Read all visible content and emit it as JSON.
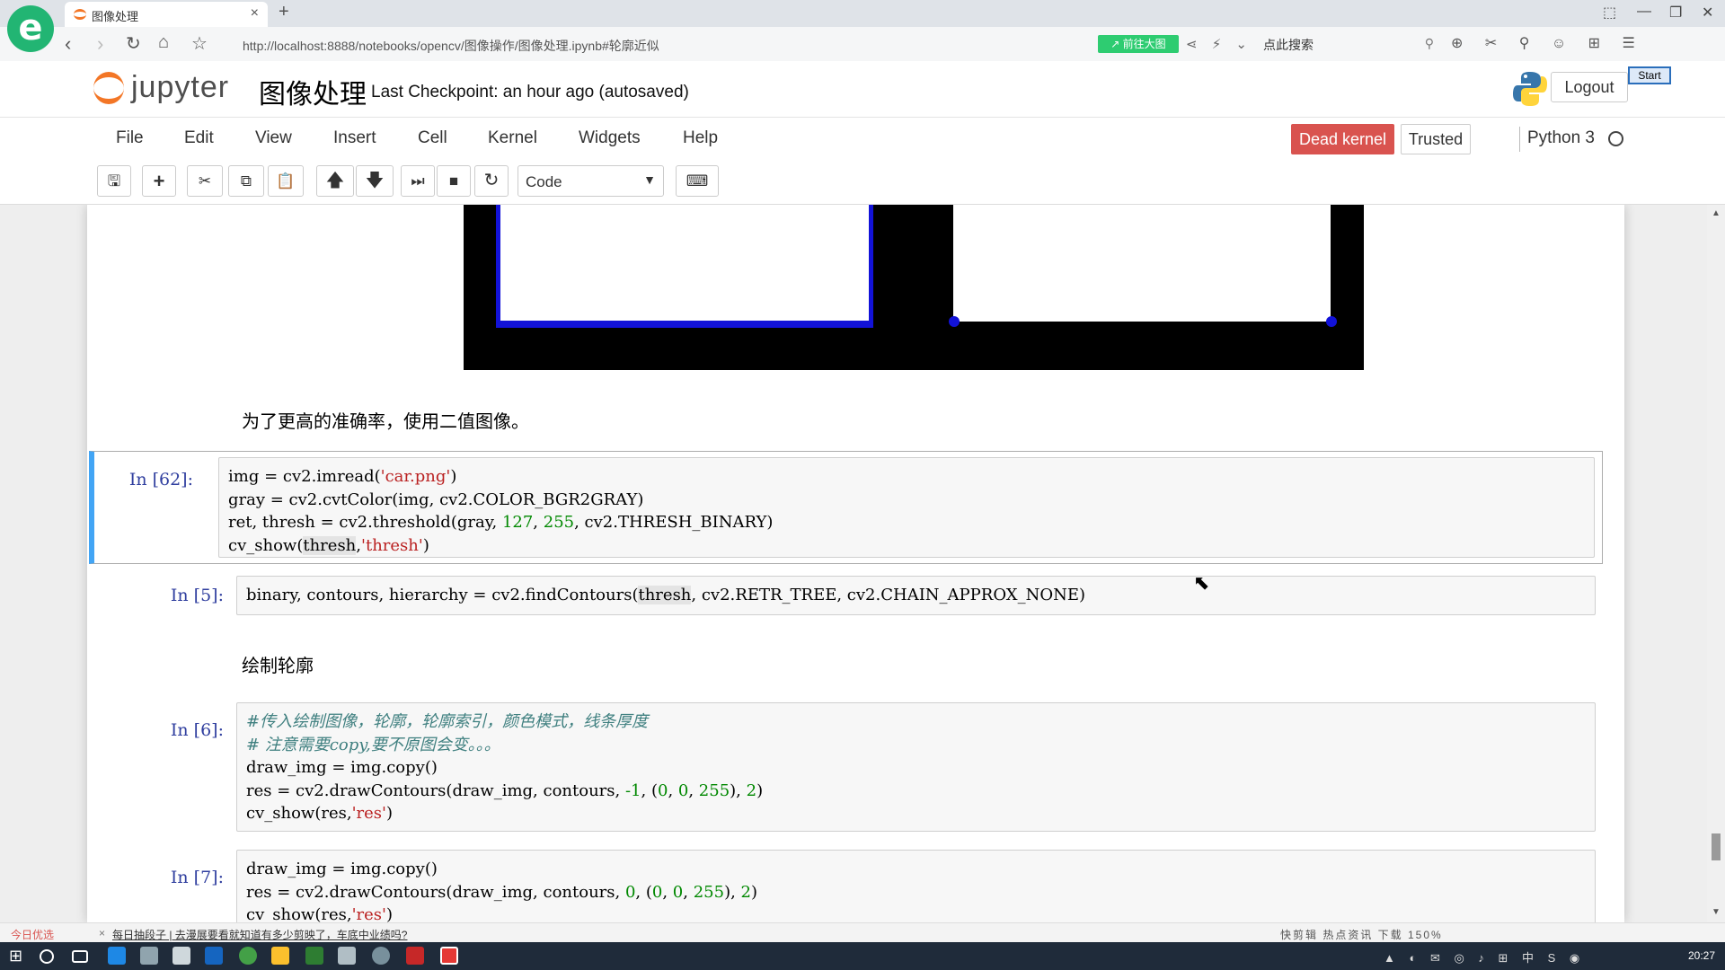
{
  "browser": {
    "tab_title": "图像处理",
    "url": "http://localhost:8888/notebooks/opencv/图像操作/图像处理.ipynb#轮廓近似",
    "url_badge": "↗ 前往大图",
    "search_placeholder": "点此搜索"
  },
  "jupyter": {
    "logo_text": "jupyter",
    "notebook_name": "图像处理",
    "checkpoint": "Last Checkpoint: an hour ago (autosaved)",
    "logout_label": "Logout",
    "start_label": "Start",
    "menu": [
      "File",
      "Edit",
      "View",
      "Insert",
      "Cell",
      "Kernel",
      "Widgets",
      "Help"
    ],
    "dead_kernel_label": "Dead kernel",
    "trusted_label": "Trusted",
    "kernel_name": "Python 3",
    "cell_type": "Code"
  },
  "notebook": {
    "markdown_1": "为了更高的准确率，使用二值图像。",
    "markdown_2": "绘制轮廓",
    "cells": [
      {
        "prompt": "In [62]:"
      },
      {
        "prompt": "In [5]:"
      },
      {
        "prompt": "In [6]:"
      },
      {
        "prompt": "In [7]:"
      }
    ]
  },
  "status_bar": {
    "left_label": "今日优选",
    "news": "每日抽段子 | 去漫展要看就知道有多少剪映了，车底中业绩吗?",
    "right_items": "快剪辑  热点资讯  下载  150%"
  },
  "taskbar": {
    "clock": "20:27"
  },
  "colors": {
    "dead_kernel": "#d9534f",
    "selected_cell": "#42a5f5",
    "prompt_in": "#303f9f",
    "string": "#ba2121",
    "number": "#008800",
    "comment": "#408080"
  }
}
